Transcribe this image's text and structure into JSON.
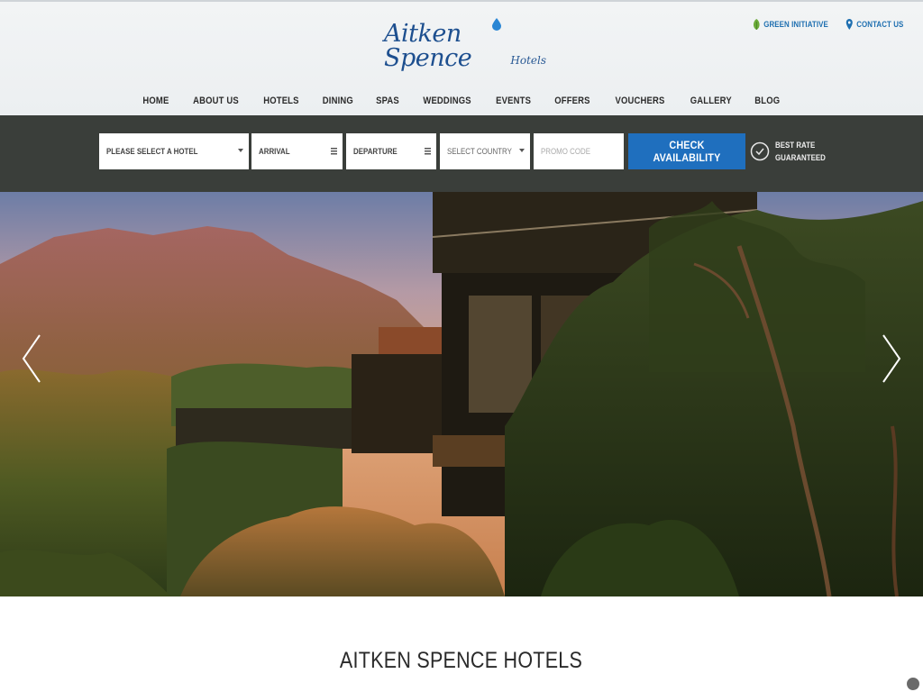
{
  "header": {
    "logo": {
      "script": "Aitken Spence",
      "suffix": "Hotels"
    },
    "utility_links": {
      "green_initiative": "GREEN INITIATIVE",
      "contact_us": "CONTACT US"
    },
    "nav": [
      "HOME",
      "ABOUT US",
      "HOTELS",
      "DINING",
      "SPAS",
      "WEDDINGS",
      "EVENTS",
      "OFFERS",
      "VOUCHERS",
      "GALLERY",
      "BLOG"
    ]
  },
  "booking": {
    "hotel_select": "PLEASE SELECT A HOTEL",
    "arrival": "ARRIVAL",
    "departure": "DEPARTURE",
    "country_select": "SELECT COUNTRY",
    "promo_placeholder": "PROMO CODE",
    "check_button": "CHECK AVAILABILITY",
    "best_rate_line1": "BEST RATE",
    "best_rate_line2": "GUARANTEED"
  },
  "hero": {
    "prev_icon": "chevron-left-icon",
    "next_icon": "chevron-right-icon"
  },
  "section": {
    "title": "AITKEN SPENCE HOTELS"
  },
  "colors": {
    "brand_blue": "#1f6fbe",
    "logo_blue": "#1d4f8f",
    "booking_bar": "#3a3e3a",
    "link_blue": "#1e6fb0",
    "green_leaf": "#6cab3a"
  }
}
